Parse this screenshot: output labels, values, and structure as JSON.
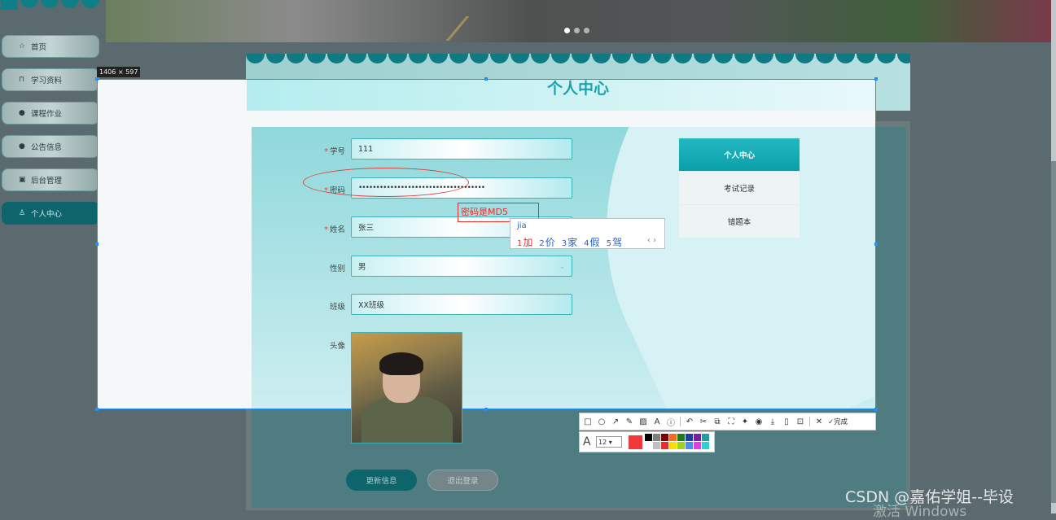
{
  "sidebar": {
    "items": [
      {
        "label": "首页",
        "icon": "star-icon"
      },
      {
        "label": "学习资料",
        "icon": "bag-icon"
      },
      {
        "label": "课程作业",
        "icon": "info-circle-icon"
      },
      {
        "label": "公告信息",
        "icon": "question-circle-icon"
      },
      {
        "label": "后台管理",
        "icon": "calendar-icon"
      },
      {
        "label": "个人中心",
        "icon": "user-icon",
        "active": true
      }
    ]
  },
  "header": {
    "title": "个人中心"
  },
  "screenshot_tool": {
    "size_label": "1406 × 597"
  },
  "form": {
    "student_id": {
      "label": "学号",
      "value": "111",
      "required": true
    },
    "password": {
      "label": "密码",
      "value": "••••••••••••••••••••••••••••••••••••",
      "required": true
    },
    "name": {
      "label": "姓名",
      "value": "张三",
      "required": true
    },
    "gender": {
      "label": "性别",
      "value": "男"
    },
    "class": {
      "label": "班级",
      "value": "XX班级"
    },
    "avatar": {
      "label": "头像"
    }
  },
  "annotation": {
    "text": "密码是MD5"
  },
  "ime": {
    "composition": "jia",
    "candidates": [
      {
        "n": "1",
        "word": "加"
      },
      {
        "n": "2",
        "word": "价"
      },
      {
        "n": "3",
        "word": "家"
      },
      {
        "n": "4",
        "word": "假"
      },
      {
        "n": "5",
        "word": "驾"
      }
    ],
    "nav": "‹ ›"
  },
  "right_menu": [
    "个人中心",
    "考试记录",
    "错题本"
  ],
  "buttons": {
    "update": "更新信息",
    "logout": "退出登录"
  },
  "toolbar": {
    "done_label": "完成",
    "font_size": "12"
  },
  "palette": [
    "#000000",
    "#808080",
    "#800000",
    "#f26b21",
    "#1f7a1f",
    "#1f3f9f",
    "#7a1f9f",
    "#1f9f9f",
    "#ffffff",
    "#c0c0c0",
    "#e03030",
    "#f5e000",
    "#9fd020",
    "#4a8ff0",
    "#e040e0",
    "#30d0d0"
  ],
  "watermark": {
    "csdn": "CSDN @嘉佑学姐--毕设",
    "windows": "激活 Windows"
  }
}
